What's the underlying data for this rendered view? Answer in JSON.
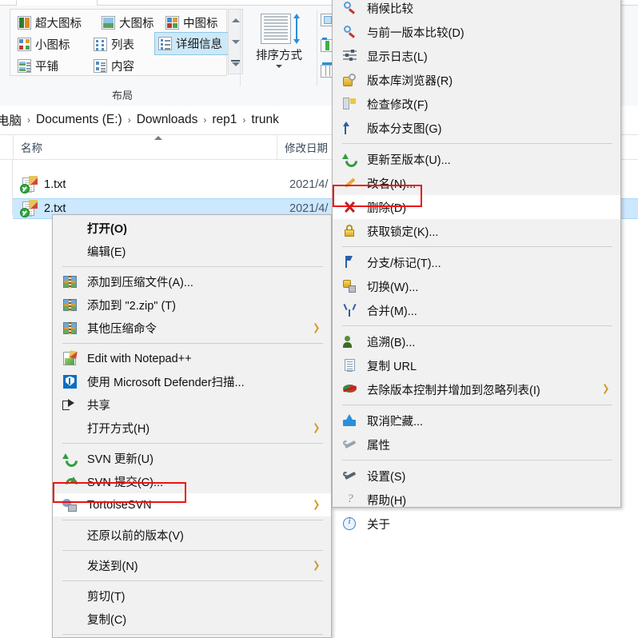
{
  "ribbon": {
    "layout_group": {
      "label": "布局",
      "views": [
        {
          "label": "超大图标",
          "icon": "extra-large-icons-icon",
          "selected": false
        },
        {
          "label": "大图标",
          "icon": "large-icons-icon",
          "selected": false
        },
        {
          "label": "中图标",
          "icon": "medium-icons-icon",
          "selected": false
        },
        {
          "label": "小图标",
          "icon": "small-icons-icon",
          "selected": false
        },
        {
          "label": "列表",
          "icon": "list-view-icon",
          "selected": false
        },
        {
          "label": "详细信息",
          "icon": "details-view-icon",
          "selected": true
        },
        {
          "label": "平铺",
          "icon": "tiles-view-icon",
          "selected": false
        },
        {
          "label": "内容",
          "icon": "content-view-icon",
          "selected": false
        }
      ],
      "scroll_up": "▲",
      "scroll_down": "▼",
      "scroll_expand": "▼"
    },
    "sort_group": {
      "label": "排序方式",
      "icon": "sort-by-icon"
    }
  },
  "breadcrumb": {
    "items": [
      "电脑",
      "Documents (E:)",
      "Downloads",
      "rep1",
      "trunk"
    ],
    "separator": "›"
  },
  "filelist": {
    "columns": [
      {
        "label": "名称",
        "sorted": true
      },
      {
        "label": "修改日期",
        "sorted": false
      }
    ],
    "rows": [
      {
        "name": "1.txt",
        "date": "2021/4/",
        "selected": false,
        "icon": "text-file-versioned-icon"
      },
      {
        "name": "2.txt",
        "date": "2021/4/",
        "selected": true,
        "icon": "text-file-versioned-icon"
      }
    ]
  },
  "context_menu": {
    "name": "file-context-menu",
    "items": [
      {
        "id": "open",
        "label": "打开(O)",
        "icon": null,
        "bold": true,
        "submenu": false
      },
      {
        "id": "edit",
        "label": "编辑(E)",
        "icon": null,
        "bold": false,
        "submenu": false
      },
      {
        "id": "sep1",
        "type": "separator"
      },
      {
        "id": "add-to-archive",
        "label": "添加到压缩文件(A)...",
        "icon": "zip-archive-icon",
        "submenu": false
      },
      {
        "id": "add-to-2zip",
        "label": "添加到 \"2.zip\" (T)",
        "icon": "zip-archive-icon",
        "submenu": false
      },
      {
        "id": "other-archive-commands",
        "label": "其他压缩命令",
        "icon": "zip-archive-icon",
        "submenu": true
      },
      {
        "id": "sep2",
        "type": "separator"
      },
      {
        "id": "edit-with-notepadpp",
        "label": "Edit with Notepad++",
        "icon": "notepadpp-icon",
        "submenu": false
      },
      {
        "id": "scan-with-defender",
        "label": "使用 Microsoft Defender扫描...",
        "icon": "defender-shield-icon",
        "submenu": false
      },
      {
        "id": "share",
        "label": "共享",
        "icon": "share-icon",
        "submenu": false
      },
      {
        "id": "open-with",
        "label": "打开方式(H)",
        "icon": null,
        "submenu": true
      },
      {
        "id": "sep3",
        "type": "separator"
      },
      {
        "id": "svn-update",
        "label": "SVN 更新(U)",
        "icon": "svn-update-arrow-icon",
        "submenu": false
      },
      {
        "id": "svn-commit",
        "label": "SVN 提交(C)...",
        "icon": "svn-commit-arrow-icon",
        "submenu": false
      },
      {
        "id": "tortoisesvn",
        "label": "TortoiseSVN",
        "icon": "tortoisesvn-icon",
        "submenu": true,
        "highlighted": true
      },
      {
        "id": "sep4",
        "type": "separator"
      },
      {
        "id": "restore-previous",
        "label": "还原以前的版本(V)",
        "icon": null,
        "submenu": false
      },
      {
        "id": "sep5",
        "type": "separator"
      },
      {
        "id": "send-to",
        "label": "发送到(N)",
        "icon": null,
        "submenu": true
      },
      {
        "id": "sep6",
        "type": "separator"
      },
      {
        "id": "cut",
        "label": "剪切(T)",
        "icon": null,
        "submenu": false
      },
      {
        "id": "copy",
        "label": "复制(C)",
        "icon": null,
        "submenu": false
      },
      {
        "id": "sep7",
        "type": "separator"
      }
    ]
  },
  "svn_submenu": {
    "name": "tortoisesvn-submenu",
    "items": [
      {
        "id": "diff-later",
        "label": "稍候比较",
        "icon": "magnifier-icon",
        "submenu": false
      },
      {
        "id": "diff-with-previous",
        "label": "与前一版本比较(D)",
        "icon": "magnifier-icon",
        "submenu": false
      },
      {
        "id": "show-log",
        "label": "显示日志(L)",
        "icon": "log-lines-icon",
        "submenu": false
      },
      {
        "id": "repo-browser",
        "label": "版本库浏览器(R)",
        "icon": "repository-browser-icon",
        "submenu": false
      },
      {
        "id": "check-modifications",
        "label": "检查修改(F)",
        "icon": "check-modifications-icon",
        "submenu": false
      },
      {
        "id": "revision-graph",
        "label": "版本分支图(G)",
        "icon": "revision-graph-icon",
        "submenu": false
      },
      {
        "id": "sep1",
        "type": "separator"
      },
      {
        "id": "update-to-revision",
        "label": "更新至版本(U)...",
        "icon": "svn-update-arrow-icon",
        "submenu": false
      },
      {
        "id": "rename",
        "label": "改名(N)...",
        "icon": "pencil-icon",
        "submenu": false
      },
      {
        "id": "delete",
        "label": "删除(D)",
        "icon": "red-x-icon",
        "submenu": false,
        "highlighted": true
      },
      {
        "id": "get-lock",
        "label": "获取锁定(K)...",
        "icon": "lock-icon",
        "submenu": false
      },
      {
        "id": "sep2",
        "type": "separator"
      },
      {
        "id": "branch-tag",
        "label": "分支/标记(T)...",
        "icon": "branch-tag-icon",
        "submenu": false
      },
      {
        "id": "switch",
        "label": "切换(W)...",
        "icon": "switch-icon",
        "submenu": false
      },
      {
        "id": "merge",
        "label": "合并(M)...",
        "icon": "merge-icon",
        "submenu": false
      },
      {
        "id": "sep3",
        "type": "separator"
      },
      {
        "id": "blame",
        "label": "追溯(B)...",
        "icon": "blame-icon",
        "submenu": false
      },
      {
        "id": "copy-url",
        "label": "复制 URL",
        "icon": "document-icon",
        "submenu": false
      },
      {
        "id": "unversion-add-ignore",
        "label": "去除版本控制并增加到忽略列表(I)",
        "icon": "ignore-icon",
        "submenu": true
      },
      {
        "id": "sep4",
        "type": "separator"
      },
      {
        "id": "unstash",
        "label": "取消贮藏...",
        "icon": "unstash-icon",
        "submenu": false
      },
      {
        "id": "properties",
        "label": "属性",
        "icon": "wrench-icon",
        "submenu": false
      },
      {
        "id": "sep5",
        "type": "separator"
      },
      {
        "id": "settings",
        "label": "设置(S)",
        "icon": "wrench-dark-icon",
        "submenu": false
      },
      {
        "id": "help",
        "label": "帮助(H)",
        "icon": "help-question-icon",
        "submenu": false
      },
      {
        "id": "about",
        "label": "关于",
        "icon": "about-info-icon",
        "submenu": false
      }
    ]
  },
  "highlights": {
    "accent_color": "#ee1111",
    "selection_color": "#cce8ff",
    "ribbon_selected_color": "#cde8f7"
  }
}
